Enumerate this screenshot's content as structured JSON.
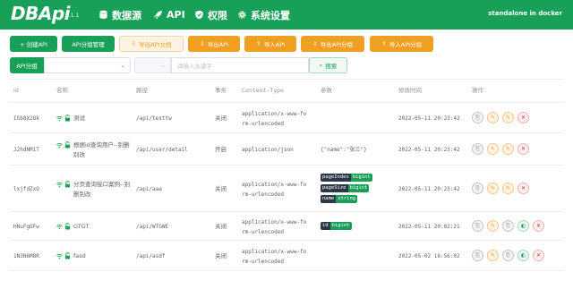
{
  "app": {
    "logo": "DBApi",
    "version": "3.1.1",
    "deploy": "standalone in docker"
  },
  "nav": [
    {
      "label": "数据源",
      "icon": "database-icon"
    },
    {
      "label": "API",
      "icon": "rocket-icon"
    },
    {
      "label": "权限",
      "icon": "shield-icon"
    },
    {
      "label": "系统设置",
      "icon": "gear-icon"
    }
  ],
  "toolbar": {
    "create_api": "+ 创建API",
    "api_group_manage": "API分组管理",
    "export_api_docs": "导出API文档",
    "export_api": "导出API",
    "import_api": "导入API",
    "export_api_group": "导出API分组",
    "import_api_group": "导入API分组"
  },
  "filter": {
    "group_label": "API分组",
    "group_value": "",
    "keyword_placeholder": "请输入关键字",
    "search_label": "搜索"
  },
  "table": {
    "headers": [
      "id",
      "名称",
      "路径",
      "事务",
      "Content-Type",
      "参数",
      "修改时间",
      "操作"
    ],
    "rows": [
      {
        "id": "ISb8X28k",
        "name": "测试",
        "path": "/api/testtw",
        "tx": "关闭",
        "ct": [
          "application/x-www-fo",
          "rm-urlencoded"
        ],
        "params_text": "",
        "params_tags": [],
        "time": "2022-05-11 20:23:42",
        "ops": [
          "gray",
          "orange",
          "orange",
          "red"
        ]
      },
      {
        "id": "J2hdNM1T",
        "name": "根据id查询用户--别删别改",
        "path": "/api/user/detail",
        "tx": "开启",
        "ct": [
          "application/json"
        ],
        "params_text": "{\"name\":\"张三\"}",
        "params_tags": [],
        "time": "2022-05-11 20:23:42",
        "ops": [
          "gray",
          "orange",
          "orange",
          "red"
        ]
      },
      {
        "id": "lxjfdZxO",
        "name": "分页查询接口案例--别删别改",
        "path": "/api/aaa",
        "tx": "关闭",
        "ct": [
          "application/x-www-fo",
          "rm-urlencoded"
        ],
        "params_text": "",
        "params_tags": [
          {
            "k": "pageIndex",
            "v": "bigint"
          },
          {
            "k": "pageSize",
            "v": "bigint"
          },
          {
            "k": "name",
            "v": "string"
          }
        ],
        "time": "2022-05-11 20:23:42",
        "ops": [
          "gray",
          "orange",
          "orange",
          "red"
        ]
      },
      {
        "id": "HNuFgOFw",
        "name": "GTGT",
        "path": "/api/WTGWE",
        "tx": "关闭",
        "ct": [
          "application/x-www-fo",
          "rm-urlencoded"
        ],
        "params_text": "",
        "params_tags": [
          {
            "k": "id",
            "v": "bigint"
          }
        ],
        "time": "2022-05-11 20:02:21",
        "ops": [
          "gray",
          "orange",
          "gray",
          "green",
          "red"
        ]
      },
      {
        "id": "1N3N6M8R",
        "name": "fasd",
        "path": "/api/asdf",
        "tx": "关闭",
        "ct": [
          "application/x-www-fo",
          "rm-urlencoded"
        ],
        "params_text": "",
        "params_tags": [],
        "time": "2022-05-02 16:56:02",
        "ops": [
          "gray",
          "orange",
          "gray",
          "green",
          "red"
        ]
      }
    ]
  },
  "colors": {
    "brand": "#18a058",
    "warning": "#f0a020",
    "danger": "#d03050"
  }
}
